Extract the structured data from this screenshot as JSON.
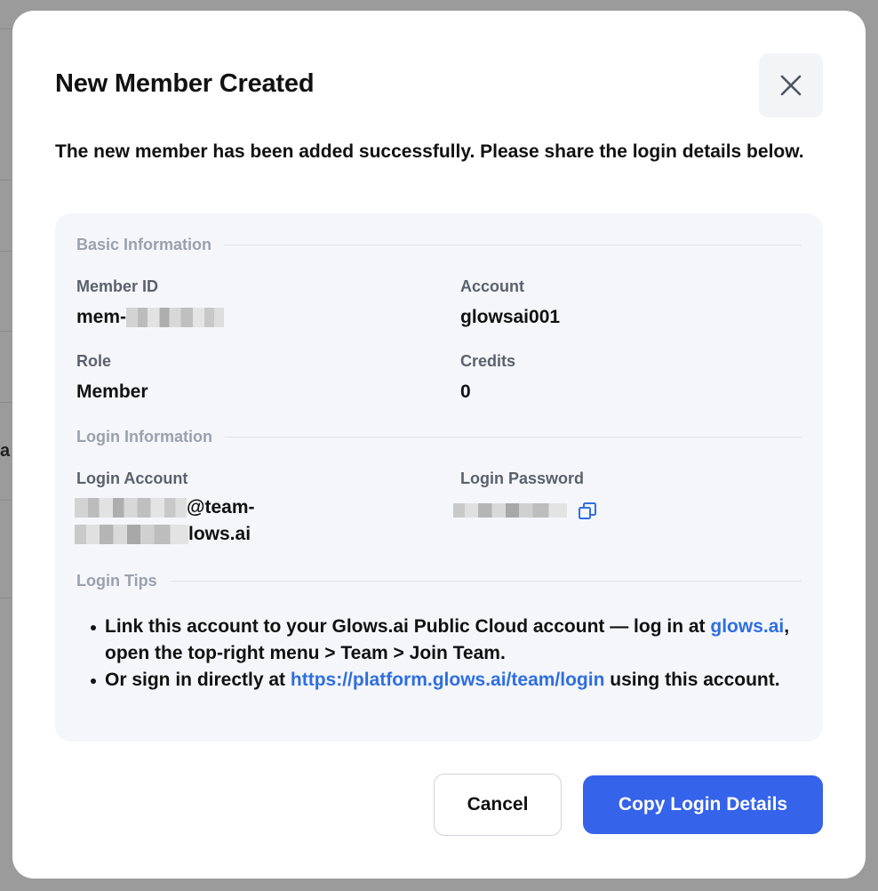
{
  "backdrop": {
    "partial_letter": "a"
  },
  "modal": {
    "title": "New Member Created",
    "close_icon": "close-icon",
    "subtitle": "The new member has been added successfully. Please share the login details below."
  },
  "basic_info": {
    "heading": "Basic Information",
    "member_id_label": "Member ID",
    "member_id_prefix": "mem-",
    "account_label": "Account",
    "account_value": "glowsai001",
    "role_label": "Role",
    "role_value": "Member",
    "credits_label": "Credits",
    "credits_value": "0"
  },
  "login_info": {
    "heading": "Login Information",
    "login_account_label": "Login Account",
    "login_account_line1_suffix": "@team-",
    "login_account_line2_suffix": "lows.ai",
    "login_password_label": "Login Password",
    "copy_icon": "copy-icon"
  },
  "login_tips": {
    "heading": "Login Tips",
    "tip1_pre": "Link this account to your Glows.ai Public Cloud account — log in at ",
    "tip1_link": "glows.ai",
    "tip1_post": ", open the top-right menu > Team > Join Team.",
    "tip2_pre": "Or sign in directly at ",
    "tip2_link": "https://platform.glows.ai/team/login",
    "tip2_post": " using this account."
  },
  "actions": {
    "cancel_label": "Cancel",
    "copy_label": "Copy Login Details"
  },
  "colors": {
    "primary": "#3563e9",
    "link": "#2f6ee0",
    "panel_bg": "#f4f6fa"
  }
}
